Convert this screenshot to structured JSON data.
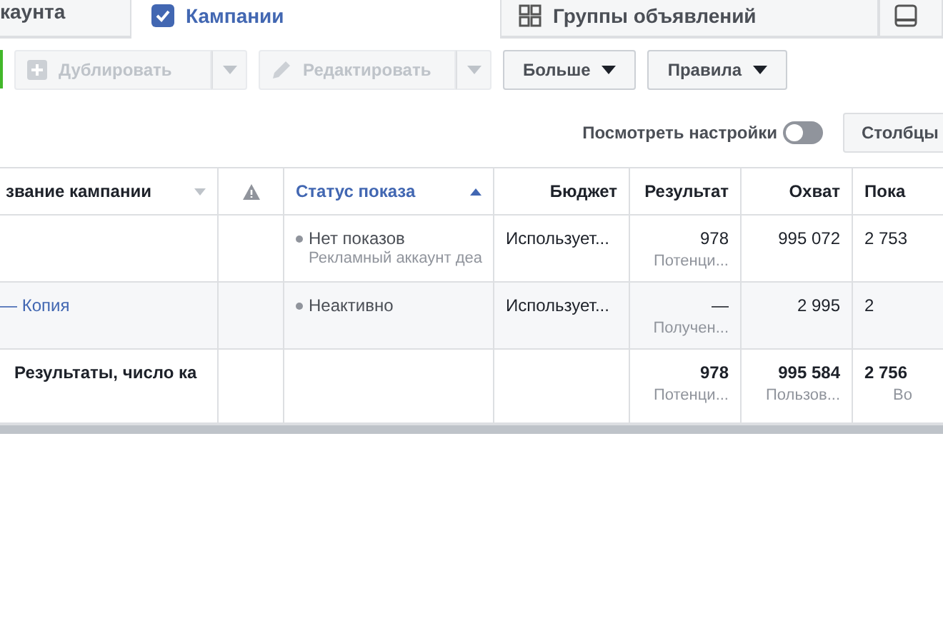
{
  "tabs": [
    {
      "label": "каунта",
      "selected": false
    },
    {
      "label": "Кампании",
      "selected": true
    },
    {
      "label": "Группы объявлений",
      "selected": false
    },
    {
      "selected": false
    }
  ],
  "toolbar": [
    {
      "label": "Дублировать",
      "kind": "split",
      "disabled": true
    },
    {
      "label": "Редактировать",
      "kind": "split",
      "disabled": true
    },
    {
      "label": "Больше",
      "kind": "menu",
      "disabled": false
    },
    {
      "label": "Правила",
      "kind": "menu",
      "disabled": false
    }
  ],
  "settings": {
    "label": "Посмотреть настройки",
    "on": false,
    "columns_button": "Столбцы"
  },
  "table": {
    "columns": [
      {
        "label": "звание кампании",
        "kind": "name",
        "sorted": false
      },
      {
        "kind": "warning",
        "sorted": false
      },
      {
        "label": "Статус показа",
        "kind": "status",
        "sorted": true
      },
      {
        "label": "Бюджет",
        "kind": "number",
        "sorted": false
      },
      {
        "label": "Результат",
        "kind": "number",
        "sorted": false
      },
      {
        "label": "Охват",
        "kind": "number",
        "sorted": false
      },
      {
        "label": "Пока",
        "kind": "edge",
        "sorted": false
      }
    ],
    "rows": [
      {
        "name": "",
        "status": "Нет показов",
        "status_sub": "Рекламный аккаунт деа",
        "budget": "Использует...",
        "result": "978",
        "result_sub": "Потенци...",
        "reach": "995 072",
        "impressions": "2 753"
      },
      {
        "name": "— Копия",
        "status": "Неактивно",
        "budget": "Использует...",
        "result": "—",
        "result_sub": "Получен...",
        "reach": "2 995",
        "impressions": "2"
      }
    ],
    "total": {
      "name": "Результаты, число ка",
      "result": "978",
      "result_sub": "Потенци...",
      "reach": "995 584",
      "reach_sub": "Пользов...",
      "impressions": "2 756",
      "impressions_sub": "Во"
    }
  }
}
